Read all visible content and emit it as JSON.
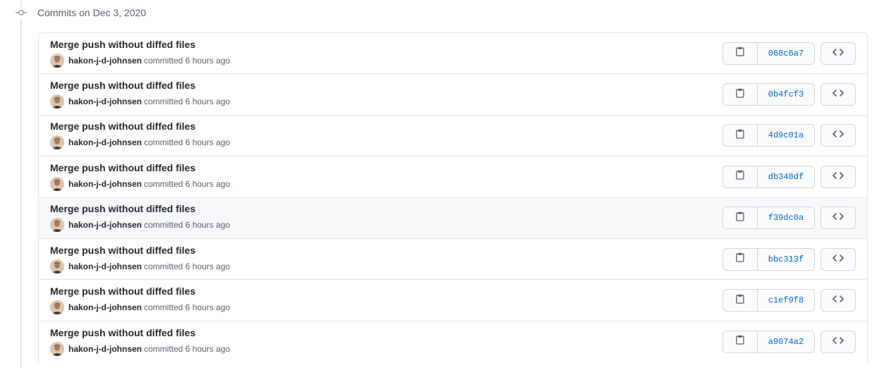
{
  "group": {
    "title": "Commits on Dec 3, 2020"
  },
  "commits": [
    {
      "title": "Merge push without diffed files",
      "author": "hakon-j-d-johnsen",
      "meta": "committed 6 hours ago",
      "sha": "068c6a7"
    },
    {
      "title": "Merge push without diffed files",
      "author": "hakon-j-d-johnsen",
      "meta": "committed 6 hours ago",
      "sha": "0b4fcf3"
    },
    {
      "title": "Merge push without diffed files",
      "author": "hakon-j-d-johnsen",
      "meta": "committed 6 hours ago",
      "sha": "4d9c01a"
    },
    {
      "title": "Merge push without diffed files",
      "author": "hakon-j-d-johnsen",
      "meta": "committed 6 hours ago",
      "sha": "db348df"
    },
    {
      "title": "Merge push without diffed files",
      "author": "hakon-j-d-johnsen",
      "meta": "committed 6 hours ago",
      "sha": "f39dc0a"
    },
    {
      "title": "Merge push without diffed files",
      "author": "hakon-j-d-johnsen",
      "meta": "committed 6 hours ago",
      "sha": "bbc313f"
    },
    {
      "title": "Merge push without diffed files",
      "author": "hakon-j-d-johnsen",
      "meta": "committed 6 hours ago",
      "sha": "c1ef9f8"
    },
    {
      "title": "Merge push without diffed files",
      "author": "hakon-j-d-johnsen",
      "meta": "committed 6 hours ago",
      "sha": "a9074a2"
    }
  ],
  "icons": {
    "commit": "git-commit-icon",
    "copy": "clipboard-icon",
    "browse": "code-icon"
  },
  "colors": {
    "sha_link": "#0366d6",
    "hover_row": "#f6f8fa"
  }
}
